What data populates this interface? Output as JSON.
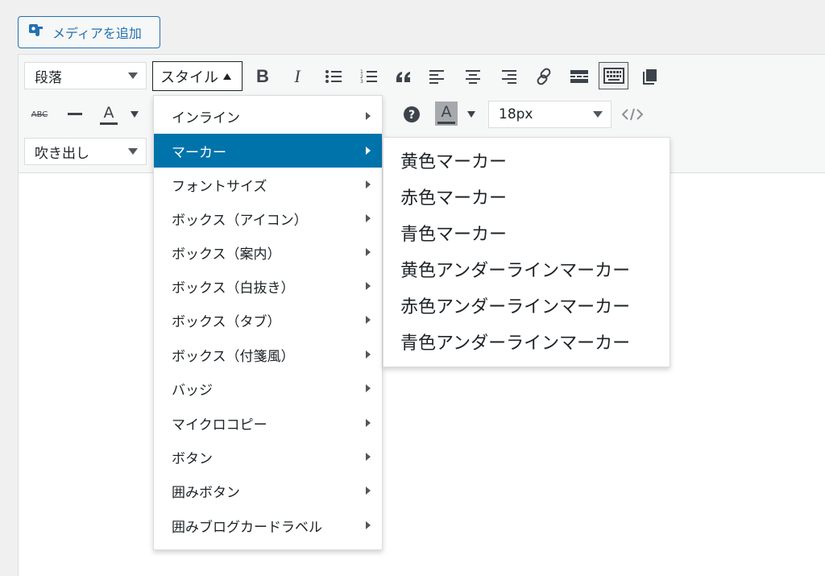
{
  "media_button": {
    "label": "メディアを追加",
    "icon": "add-media-icon"
  },
  "toolbar": {
    "format_select": "段落",
    "style_button": "スタイル",
    "font_size_select": "18px",
    "speech_select": "吹き出し",
    "bold_label": "B",
    "italic_label": "I",
    "text_color_label": "A",
    "bg_color_label": "A",
    "strike_label": "ABC",
    "icons": [
      "bold-icon",
      "italic-icon",
      "bullet-list-icon",
      "numbered-list-icon",
      "blockquote-icon",
      "align-left-icon",
      "align-center-icon",
      "align-right-icon",
      "link-icon",
      "read-more-icon",
      "toolbar-toggle-icon",
      "copy-icon",
      "strikethrough-icon",
      "horizontal-line-icon",
      "text-color-icon",
      "help-icon",
      "background-color-icon",
      "code-icon"
    ]
  },
  "style_menu": {
    "items": [
      {
        "label": "インライン"
      },
      {
        "label": "マーカー"
      },
      {
        "label": "フォントサイズ"
      },
      {
        "label": "ボックス（アイコン）"
      },
      {
        "label": "ボックス（案内）"
      },
      {
        "label": "ボックス（白抜き）"
      },
      {
        "label": "ボックス（タブ）"
      },
      {
        "label": "ボックス（付箋風）"
      },
      {
        "label": "バッジ"
      },
      {
        "label": "マイクロコピー"
      },
      {
        "label": "ボタン"
      },
      {
        "label": "囲みボタン"
      },
      {
        "label": "囲みブログカードラベル"
      }
    ],
    "active_label": "マーカー"
  },
  "marker_submenu": {
    "items": [
      "黄色マーカー",
      "赤色マーカー",
      "青色マーカー",
      "黄色アンダーラインマーカー",
      "赤色アンダーラインマーカー",
      "青色アンダーラインマーカー"
    ]
  },
  "colors": {
    "accent": "#2271b1",
    "menu_active": "#0073aa"
  }
}
